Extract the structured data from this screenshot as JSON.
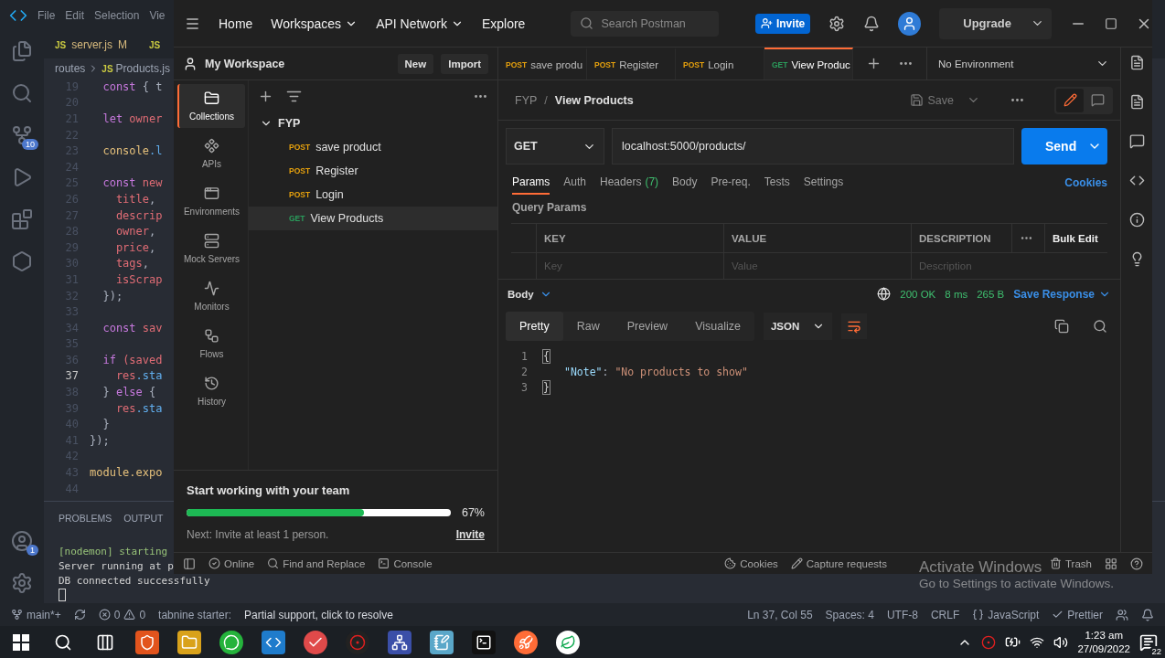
{
  "vscode": {
    "menu": [
      "File",
      "Edit",
      "Selection",
      "Vie"
    ],
    "source_control_badge": "10",
    "accounts_badge": "1",
    "tabs": [
      {
        "badge": "JS",
        "label": "server.js",
        "status": "M"
      },
      {
        "badge": "JS"
      }
    ],
    "breadcrumb": {
      "folder": "routes",
      "badge": "JS",
      "file": "Products.js"
    },
    "code_lines": [
      {
        "number": "19",
        "active": false,
        "tokens": [
          {
            "text": "  const",
            "kind": "kw"
          },
          {
            "text": " { t",
            "kind": "punct"
          }
        ]
      },
      {
        "number": "20",
        "active": false
      },
      {
        "number": "21",
        "active": false,
        "tokens": [
          {
            "text": "  let",
            "kind": "kw"
          },
          {
            "text": " owner",
            "kind": "var"
          }
        ]
      },
      {
        "number": "22",
        "active": false
      },
      {
        "number": "23",
        "active": false,
        "tokens": [
          {
            "text": "  console",
            "kind": "obj"
          },
          {
            "text": ".l",
            "kind": "method"
          }
        ]
      },
      {
        "number": "24",
        "active": false
      },
      {
        "number": "25",
        "active": false,
        "tokens": [
          {
            "text": "  const",
            "kind": "kw"
          },
          {
            "text": " new",
            "kind": "var"
          }
        ]
      },
      {
        "number": "26",
        "active": false,
        "tokens": [
          {
            "text": "    title",
            "kind": "var"
          },
          {
            "text": ",",
            "kind": "punct"
          }
        ]
      },
      {
        "number": "27",
        "active": false,
        "tokens": [
          {
            "text": "    descrip",
            "kind": "var"
          }
        ]
      },
      {
        "number": "28",
        "active": false,
        "tokens": [
          {
            "text": "    owner",
            "kind": "var"
          },
          {
            "text": ",",
            "kind": "punct"
          }
        ]
      },
      {
        "number": "29",
        "active": false,
        "tokens": [
          {
            "text": "    price",
            "kind": "var"
          },
          {
            "text": ",",
            "kind": "punct"
          }
        ]
      },
      {
        "number": "30",
        "active": false,
        "tokens": [
          {
            "text": "    tags",
            "kind": "var"
          },
          {
            "text": ",",
            "kind": "punct"
          }
        ]
      },
      {
        "number": "31",
        "active": false,
        "tokens": [
          {
            "text": "    isScrap",
            "kind": "var"
          }
        ]
      },
      {
        "number": "32",
        "active": false,
        "tokens": [
          {
            "text": "  });",
            "kind": "punct"
          }
        ]
      },
      {
        "number": "33",
        "active": false
      },
      {
        "number": "34",
        "active": false,
        "tokens": [
          {
            "text": "  const",
            "kind": "kw"
          },
          {
            "text": " sav",
            "kind": "var"
          }
        ]
      },
      {
        "number": "35",
        "active": false
      },
      {
        "number": "36",
        "active": false,
        "tokens": [
          {
            "text": "  if",
            "kind": "kw"
          },
          {
            "text": " (saved",
            "kind": "var"
          }
        ]
      },
      {
        "number": "37",
        "active": true,
        "tokens": [
          {
            "text": "    res",
            "kind": "var"
          },
          {
            "text": ".sta",
            "kind": "method"
          }
        ]
      },
      {
        "number": "38",
        "active": false,
        "tokens": [
          {
            "text": "  }",
            "kind": "punct"
          },
          {
            "text": " else",
            "kind": "kw"
          },
          {
            "text": " {",
            "kind": "punct"
          }
        ]
      },
      {
        "number": "39",
        "active": false,
        "tokens": [
          {
            "text": "    res",
            "kind": "var"
          },
          {
            "text": ".sta",
            "kind": "method"
          }
        ]
      },
      {
        "number": "40",
        "active": false,
        "tokens": [
          {
            "text": "  }",
            "kind": "punct"
          }
        ]
      },
      {
        "number": "41",
        "active": false,
        "tokens": [
          {
            "text": "});",
            "kind": "punct"
          }
        ]
      },
      {
        "number": "42",
        "active": false
      },
      {
        "number": "43",
        "active": false,
        "tokens": [
          {
            "text": "module.expo",
            "kind": "obj"
          }
        ]
      },
      {
        "number": "44",
        "active": false
      }
    ],
    "panel_tabs": [
      "PROBLEMS",
      "OUTPUT"
    ],
    "terminal": [
      {
        "text": "[nodemon] starting",
        "kind": "info"
      },
      {
        "text": "Server running at p",
        "kind": "plain"
      },
      {
        "text": "DB connected successfully",
        "kind": "plain"
      }
    ],
    "status_bar": {
      "branch": "main*+",
      "errors": "0",
      "warnings": "0",
      "tabnine": "tabnine starter:",
      "message": "Partial support, click to resolve",
      "position": "Ln 37, Col 55",
      "indent": "Spaces: 4",
      "encoding": "UTF-8",
      "eol": "CRLF",
      "language": "JavaScript",
      "formatter": "Prettier"
    }
  },
  "postman": {
    "nav": [
      {
        "label": "Home",
        "dropdown": false
      },
      {
        "label": "Workspaces",
        "dropdown": true
      },
      {
        "label": "API Network",
        "dropdown": true
      },
      {
        "label": "Explore",
        "dropdown": false
      }
    ],
    "search_placeholder": "Search Postman",
    "invite_button": "Invite",
    "upgrade_button": "Upgrade",
    "workspace": {
      "name": "My Workspace",
      "buttons": [
        "New",
        "Import"
      ]
    },
    "rail": [
      {
        "label": "Collections",
        "selected": true
      },
      {
        "label": "APIs",
        "selected": false
      },
      {
        "label": "Environments",
        "selected": false
      },
      {
        "label": "Mock Servers",
        "selected": false
      },
      {
        "label": "Monitors",
        "selected": false
      },
      {
        "label": "Flows",
        "selected": false
      },
      {
        "label": "History",
        "selected": false
      }
    ],
    "tree": {
      "name": "FYP",
      "expanded": true,
      "children": [
        {
          "method": "POST",
          "color": "#e5a00d",
          "name": "save product",
          "selected": false
        },
        {
          "method": "POST",
          "color": "#e5a00d",
          "name": "Register",
          "selected": false
        },
        {
          "method": "POST",
          "color": "#e5a00d",
          "name": "Login",
          "selected": false
        },
        {
          "method": "GET",
          "color": "#2a9d5c",
          "name": "View Products",
          "selected": true
        }
      ]
    },
    "onboarding": {
      "title": "Start working with your team",
      "level": 0.67,
      "percent": "67%",
      "next": "Next: Invite at least 1 person.",
      "link": "Invite"
    },
    "tabs": [
      {
        "method": "POST",
        "color": "#e5a00d",
        "label": "save produ",
        "selected": false
      },
      {
        "method": "POST",
        "color": "#e5a00d",
        "label": "Register",
        "selected": false
      },
      {
        "method": "POST",
        "color": "#e5a00d",
        "label": "Login",
        "selected": false
      },
      {
        "method": "GET",
        "color": "#2a9d5c",
        "label": "View Produc",
        "selected": true
      }
    ],
    "environment": "No Environment",
    "breadcrumb": {
      "collection": "FYP",
      "separator": "/",
      "request": "View Products"
    },
    "save_button": "Save",
    "request": {
      "method": "GET",
      "url": "localhost:5000/products/",
      "send": "Send"
    },
    "request_tabs": [
      {
        "label": "Params",
        "selected": true
      },
      {
        "label": "Auth",
        "selected": false
      },
      {
        "label": "Headers",
        "count": "(7)",
        "selected": false
      },
      {
        "label": "Body",
        "selected": false
      },
      {
        "label": "Pre-req.",
        "selected": false
      },
      {
        "label": "Tests",
        "selected": false
      },
      {
        "label": "Settings",
        "selected": false
      }
    ],
    "cookies_link": "Cookies",
    "query_params_title": "Query Params",
    "params_table": {
      "columns": [
        "KEY",
        "VALUE",
        "DESCRIPTION"
      ],
      "bulk_edit": "Bulk Edit",
      "placeholders": [
        "Key",
        "Value",
        "Description"
      ]
    },
    "response": {
      "section": "Body",
      "status": "200 OK",
      "time": "8 ms",
      "size": "265 B",
      "save": "Save Response",
      "view_tabs": [
        {
          "label": "Pretty",
          "selected": true
        },
        {
          "label": "Raw",
          "selected": false
        },
        {
          "label": "Preview",
          "selected": false
        },
        {
          "label": "Visualize",
          "selected": false
        }
      ],
      "format": "JSON",
      "lines": [
        {
          "number": "1",
          "tokens": [
            {
              "text": "{",
              "kind": "brace"
            }
          ]
        },
        {
          "number": "2",
          "tokens": [
            {
              "text": "\"Note\"",
              "kind": "key"
            },
            {
              "text": ": ",
              "kind": "punct"
            },
            {
              "text": "\"No products to show\"",
              "kind": "string"
            }
          ]
        },
        {
          "number": "3",
          "tokens": [
            {
              "text": "}",
              "kind": "brace"
            }
          ]
        }
      ]
    },
    "status_bar": {
      "left": [
        "Online",
        "Find and Replace",
        "Console"
      ],
      "right": [
        "Cookies",
        "Capture requests",
        "Trash"
      ]
    }
  },
  "taskbar": {
    "time": "1:23 am",
    "date": "27/09/2022",
    "notifications": "22"
  },
  "activation_notice": {
    "title": "Activate Windows",
    "text": "Go to Settings to activate Windows."
  }
}
